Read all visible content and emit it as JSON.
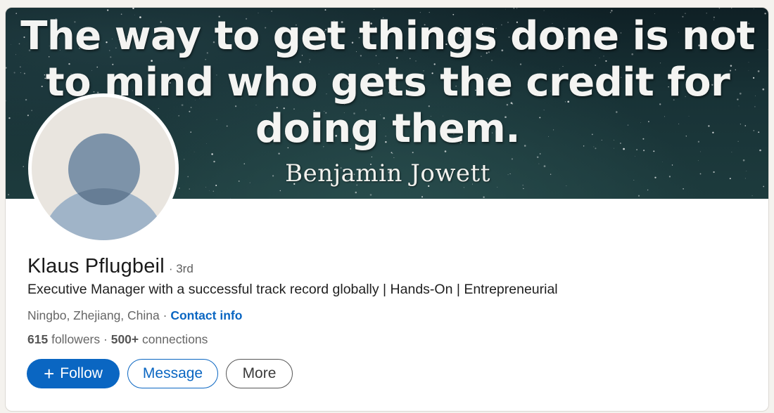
{
  "banner": {
    "quote": "The way to get things done is not\nto mind who gets the credit for\ndoing them.",
    "author": "Benjamin Jowett"
  },
  "profile": {
    "name": "Klaus Pflugbeil",
    "degree": "· 3rd",
    "headline": "Executive Manager with a successful track record globally | Hands-On | Entrepreneurial",
    "location": "Ningbo, Zhejiang, China",
    "location_sep": " · ",
    "contact_info": "Contact info",
    "followers_count": "615",
    "followers_label": "followers",
    "stats_sep": " · ",
    "connections_count": "500+",
    "connections_label": "connections"
  },
  "actions": {
    "follow_icon": "+",
    "follow_label": "Follow",
    "message_label": "Message",
    "more_label": "More"
  },
  "colors": {
    "brand_blue": "#0a66c2",
    "page_bg": "#f4f2ee"
  }
}
